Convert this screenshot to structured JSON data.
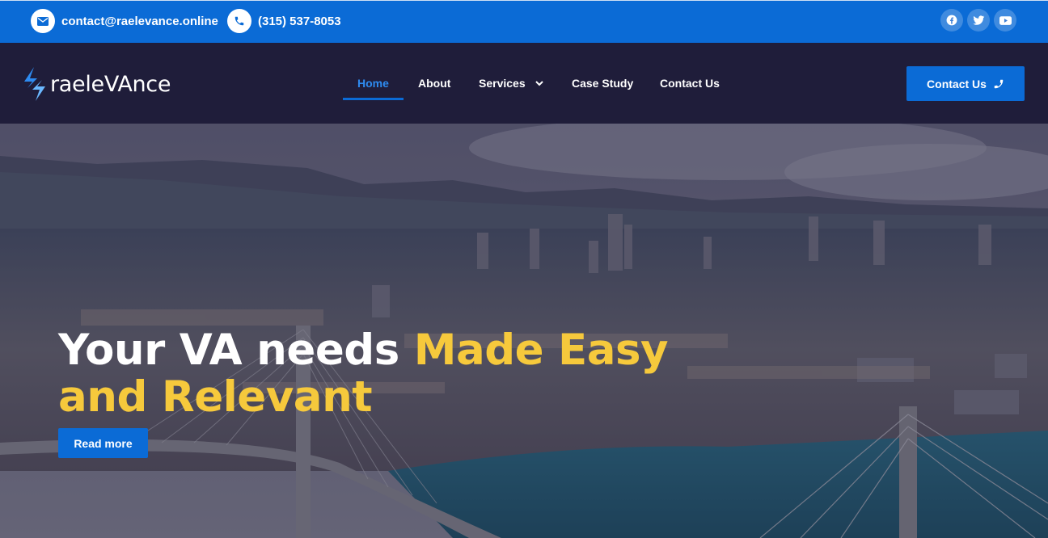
{
  "topbar": {
    "email": "contact@raelevance.online",
    "phone": "(315) 537-8053",
    "icons": {
      "email": "envelope-icon",
      "phone": "phone-icon"
    },
    "social": [
      "facebook-icon",
      "twitter-icon",
      "youtube-icon"
    ]
  },
  "nav": {
    "logo_text": "raeleVAnce",
    "items": [
      {
        "label": "Home",
        "active": true
      },
      {
        "label": "About"
      },
      {
        "label": "Services",
        "has_dropdown": true
      },
      {
        "label": "Case Study"
      },
      {
        "label": "Contact Us"
      }
    ],
    "cta_label": "Contact Us"
  },
  "hero": {
    "headline_white": "Your VA needs ",
    "headline_yellow": "Made Easy",
    "headline_line2": "and Relevant",
    "button_label": "Read more"
  },
  "colors": {
    "primary": "#0b6bd6",
    "nav_bg": "#1f1d3a",
    "highlight": "#f6c93c",
    "active_link": "#2e8bf0"
  }
}
